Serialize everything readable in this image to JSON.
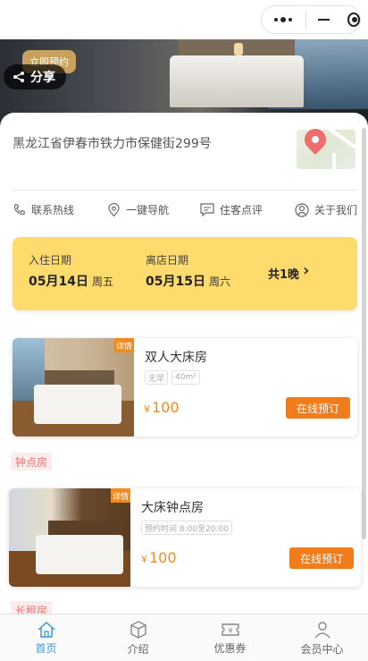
{
  "topbar": {
    "menu_icon": "more-dots-icon",
    "minimize_icon": "minimize-icon",
    "close_icon": "target-icon"
  },
  "banner": {
    "reserve_label": "立即预约",
    "share_label": "分享"
  },
  "hotel": {
    "address": "黑龙江省伊春市铁力市保健街299号"
  },
  "quick_actions": [
    {
      "label": "联系热线",
      "icon": "phone-icon"
    },
    {
      "label": "一键导航",
      "icon": "location-pin-icon"
    },
    {
      "label": "住客点评",
      "icon": "comment-icon"
    },
    {
      "label": "关于我们",
      "icon": "user-icon"
    }
  ],
  "booking": {
    "checkin_label": "入住日期",
    "checkin_date": "05月14日",
    "checkin_weekday": "周五",
    "checkout_label": "离店日期",
    "checkout_date": "05月15日",
    "checkout_weekday": "周六",
    "nights": "共1晚"
  },
  "rooms": [
    {
      "name": "双人大床房",
      "detail": "详情",
      "tags": [
        "无早",
        "40m²"
      ],
      "currency": "¥",
      "price": "100",
      "book": "在线预订"
    },
    {
      "name": "大床钟点房",
      "detail": "详情",
      "tags": [
        "预约时间 8:00至20:00"
      ],
      "currency": "¥",
      "price": "100",
      "book": "在线预订"
    }
  ],
  "sections": {
    "hourly": "钟点房",
    "longterm": "长租房"
  },
  "tabbar": [
    {
      "label": "首页",
      "icon": "home-icon",
      "active": true
    },
    {
      "label": "介绍",
      "icon": "cube-icon",
      "active": false
    },
    {
      "label": "优惠券",
      "icon": "coupon-icon",
      "active": false
    },
    {
      "label": "会员中心",
      "icon": "member-icon",
      "active": false
    }
  ],
  "colors": {
    "accent": "#f07c1b",
    "date_card": "#fedb6d",
    "tab_active": "#3a9be0",
    "section_tag": "#e57676"
  }
}
